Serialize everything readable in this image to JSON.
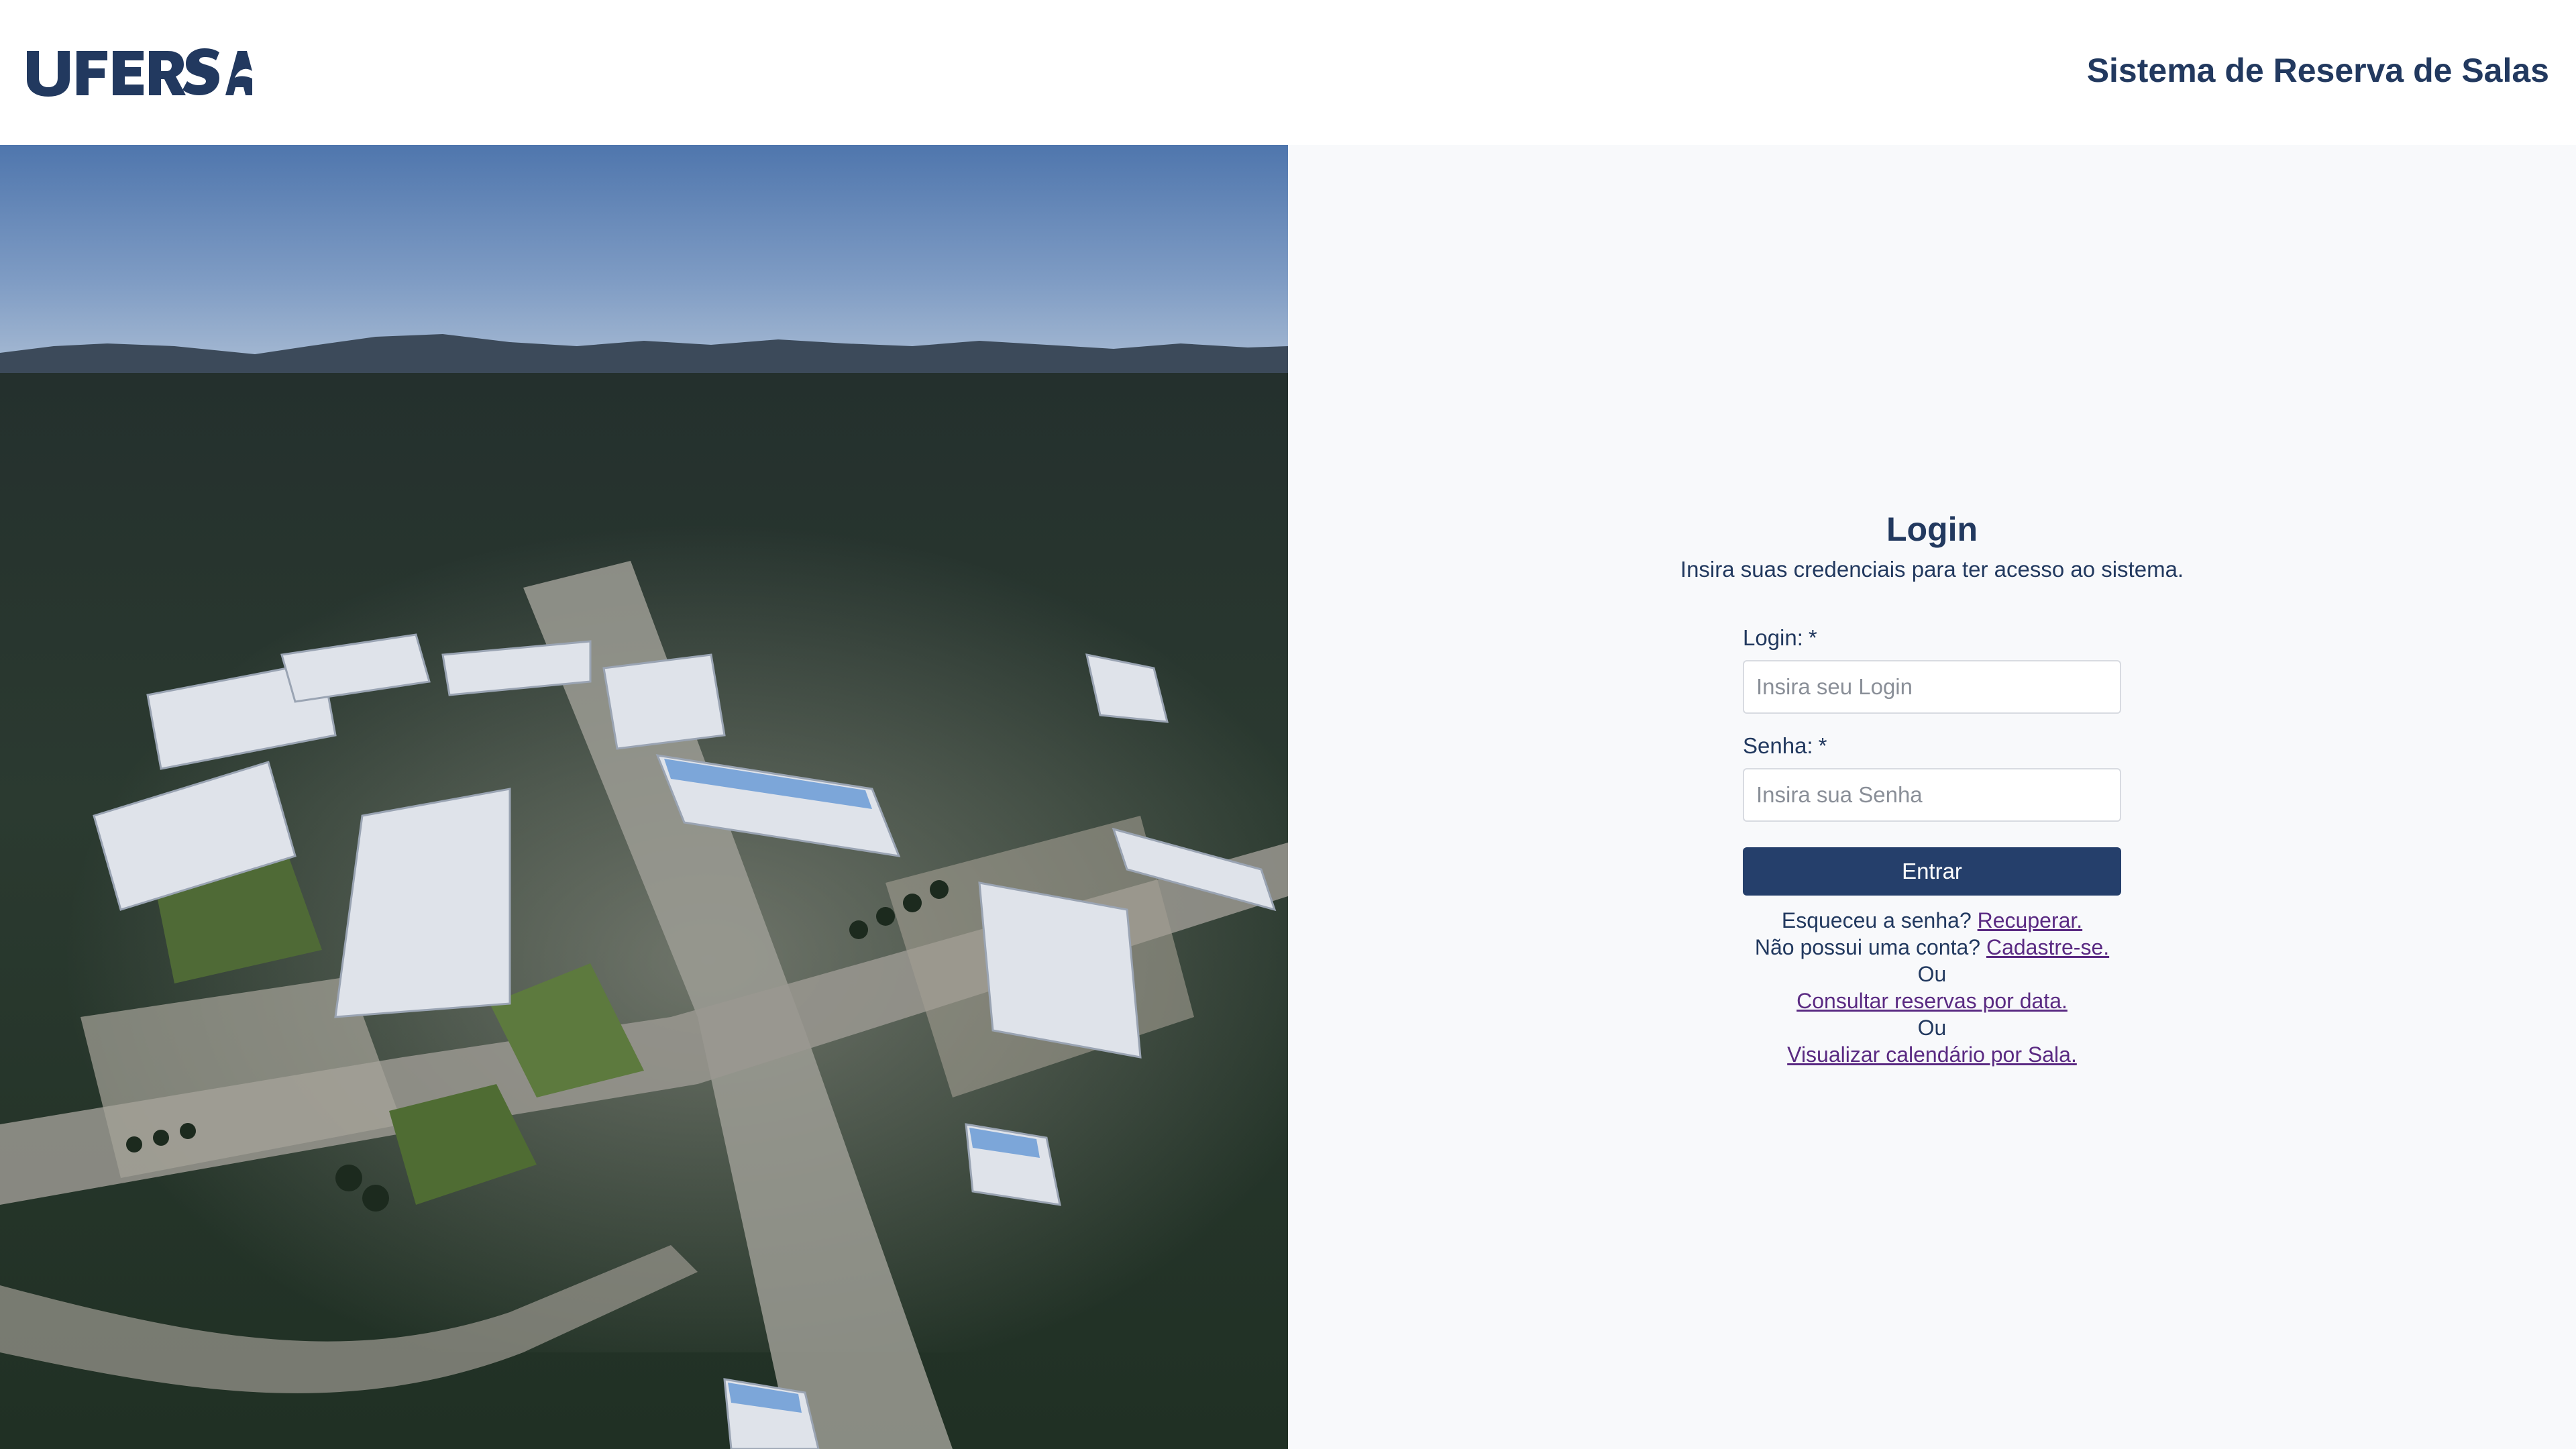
{
  "header": {
    "logo_text": "UFERSA",
    "system_title": "Sistema de Reserva de Salas"
  },
  "login": {
    "title": "Login",
    "subtitle": "Insira suas credenciais para ter acesso ao sistema.",
    "login_label": "Login:",
    "login_required": "*",
    "login_placeholder": "Insira seu Login",
    "login_value": "",
    "password_label": "Senha:",
    "password_required": "*",
    "password_placeholder": "Insira sua Senha",
    "password_value": "",
    "submit_label": "Entrar",
    "forgot_text": "Esqueceu a senha?",
    "forgot_link": "Recuperar.",
    "register_text": "Não possui uma conta?",
    "register_link": "Cadastre-se.",
    "or_1": "Ou",
    "consult_link": "Consultar reservas por data.",
    "or_2": "Ou",
    "calendar_link": "Visualizar calendário por Sala."
  },
  "colors": {
    "brand": "#22395f",
    "button": "#253f6b",
    "link": "#5a2a82",
    "pane_background": "#f8f9fb"
  },
  "image": {
    "subject": "aerial-campus-photo"
  }
}
